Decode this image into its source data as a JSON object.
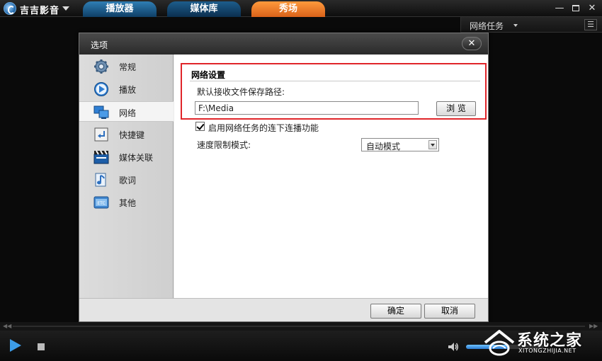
{
  "app": {
    "title": "吉吉影音",
    "tabs": [
      {
        "label": "播放器"
      },
      {
        "label": "媒体库"
      },
      {
        "label": "秀场"
      }
    ],
    "window_buttons": {
      "minimize": "—",
      "close": "✕"
    }
  },
  "network_panel": {
    "title": "网络任务",
    "menu_icon": "☰"
  },
  "dialog": {
    "title": "选项",
    "close_glyph": "✕",
    "sidebar": {
      "items": [
        {
          "label": "常规",
          "icon": "gear-icon"
        },
        {
          "label": "播放",
          "icon": "play-circle-icon"
        },
        {
          "label": "网络",
          "icon": "network-icon",
          "active": true
        },
        {
          "label": "快捷键",
          "icon": "enter-key-icon"
        },
        {
          "label": "媒体关联",
          "icon": "clapperboard-icon"
        },
        {
          "label": "歌词",
          "icon": "music-note-icon"
        },
        {
          "label": "其他",
          "icon": "etc-icon"
        }
      ]
    },
    "network_settings": {
      "section_title": "网络设置",
      "save_path_label": "默认接收文件保存路径:",
      "save_path_value": "F:\\Media",
      "browse_label": "浏 览",
      "continuous_play_label": "启用网络任务的连下连播功能",
      "continuous_play_checked": true,
      "speed_mode_label": "速度限制模式:",
      "speed_mode_value": "自动模式"
    },
    "footer": {
      "ok_label": "确定",
      "cancel_label": "取消"
    }
  },
  "player": {
    "volume_level": 0.55
  },
  "watermark": {
    "text": "系统之家",
    "url": "XITONGZHIJIA.NET"
  },
  "colors": {
    "accent_blue": "#2f7eb4",
    "show_tab_orange": "#ff9a3c",
    "highlight_red": "#e0252a"
  }
}
